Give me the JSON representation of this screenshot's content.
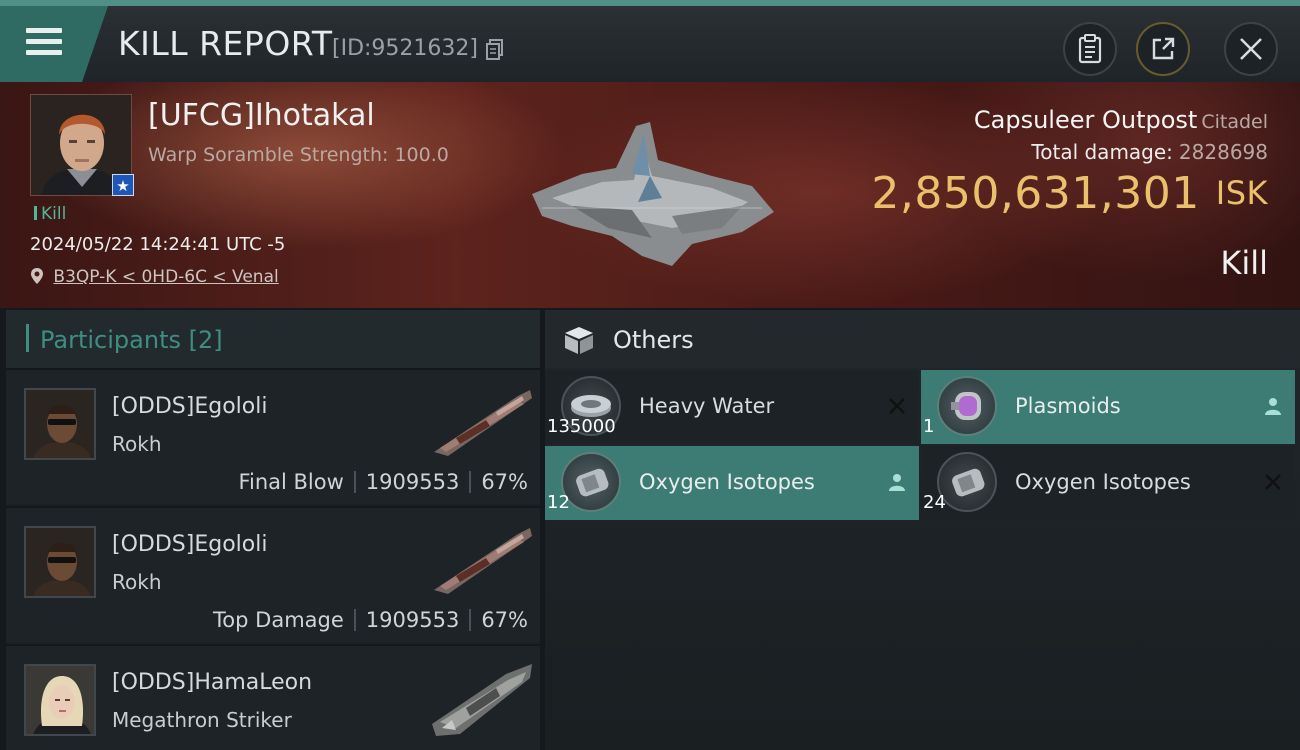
{
  "header": {
    "title": "KILL REPORT",
    "report_id": "[ID:9521632]"
  },
  "victim": {
    "name": "[UFCG]Ihotakal",
    "warp_scramble": "Warp Soramble Strength: 100.0",
    "tag": "Kill",
    "datetime": "2024/05/22 14:24:41 UTC -5",
    "location": "B3QP-K < 0HD-6C < Venal"
  },
  "target": {
    "name": "Capsuleer Outpost",
    "type": "Citadel",
    "damage_label": "Total damage:",
    "damage_value": "2828698",
    "isk_value": "2,850,631,301",
    "isk_unit": "ISK",
    "result": "Kill"
  },
  "participants": {
    "header_label": "Participants [2]",
    "rows": [
      {
        "name": "[ODDS]Egololi",
        "ship": "Rokh",
        "role": "Final Blow",
        "damage": "1909553",
        "percent": "67%"
      },
      {
        "name": "[ODDS]Egololi",
        "ship": "Rokh",
        "role": "Top Damage",
        "damage": "1909553",
        "percent": "67%"
      },
      {
        "name": "[ODDS]HamaLeon",
        "ship": "Megathron Striker"
      }
    ]
  },
  "others": {
    "header_label": "Others",
    "items": [
      {
        "name": "Heavy Water",
        "qty": "135000",
        "mark": "x-icon",
        "highlight": false
      },
      {
        "name": "Plasmoids",
        "qty": "1",
        "mark": "person-icon",
        "highlight": true
      },
      {
        "name": "Oxygen Isotopes",
        "qty": "12",
        "mark": "person-icon",
        "highlight": true
      },
      {
        "name": "Oxygen Isotopes",
        "qty": "24",
        "mark": "x-icon",
        "highlight": false
      }
    ]
  },
  "colors": {
    "accent_teal": "#3f8d83",
    "isk_gold": "#ebc06a",
    "banner_red": "#5d231d"
  }
}
